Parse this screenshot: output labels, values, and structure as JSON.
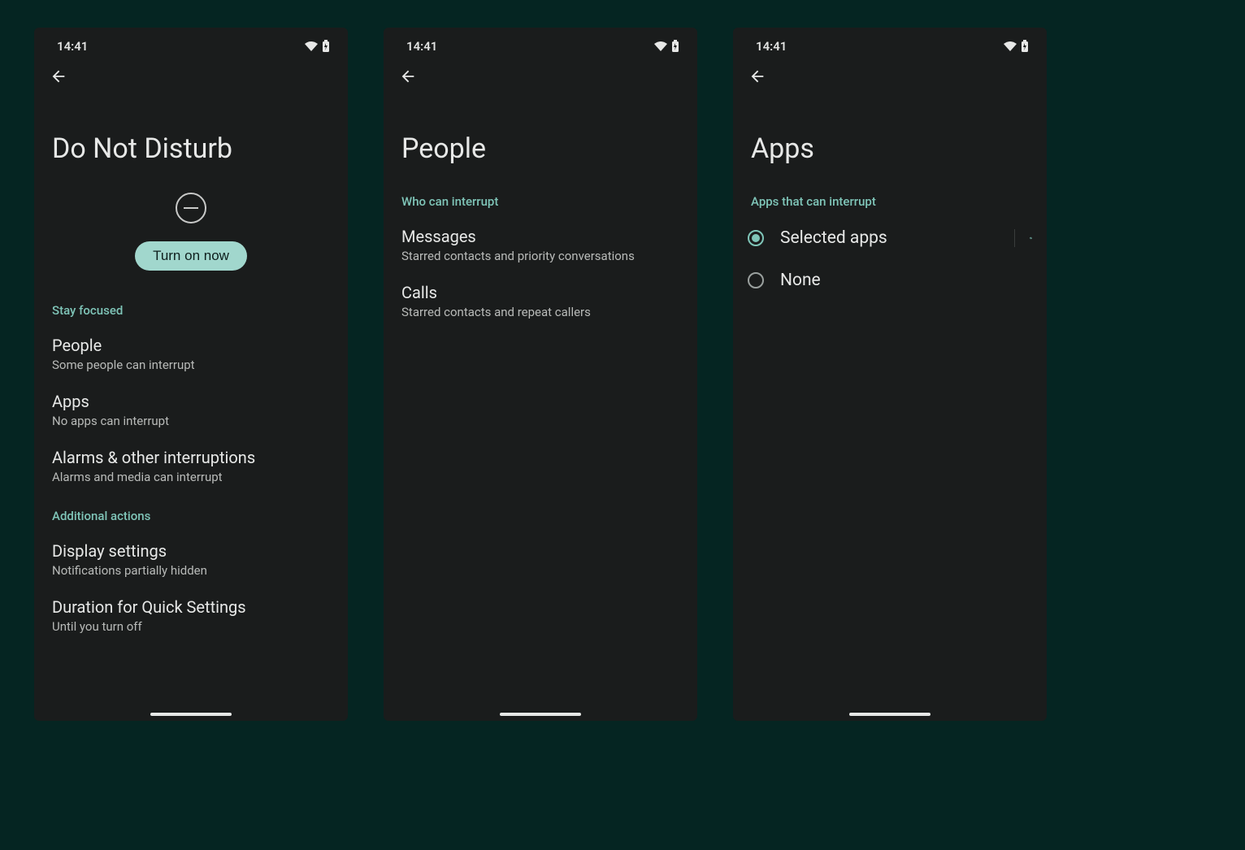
{
  "status": {
    "time": "14:41"
  },
  "screens": {
    "dnd": {
      "title": "Do Not Disturb",
      "turn_on": "Turn on now",
      "section1": "Stay focused",
      "items1": [
        {
          "title": "People",
          "sub": "Some people can interrupt"
        },
        {
          "title": "Apps",
          "sub": "No apps can interrupt"
        },
        {
          "title": "Alarms & other interruptions",
          "sub": "Alarms and media can interrupt"
        }
      ],
      "section2": "Additional actions",
      "items2": [
        {
          "title": "Display settings",
          "sub": "Notifications partially hidden"
        },
        {
          "title": "Duration for Quick Settings",
          "sub": "Until you turn off"
        }
      ]
    },
    "people": {
      "title": "People",
      "section": "Who can interrupt",
      "items": [
        {
          "title": "Messages",
          "sub": "Starred contacts and priority conversations"
        },
        {
          "title": "Calls",
          "sub": "Starred contacts and repeat callers"
        }
      ]
    },
    "apps": {
      "title": "Apps",
      "section": "Apps that can interrupt",
      "options": [
        {
          "label": "Selected apps",
          "selected": true,
          "gear": true
        },
        {
          "label": "None",
          "selected": false,
          "gear": false
        }
      ]
    }
  }
}
